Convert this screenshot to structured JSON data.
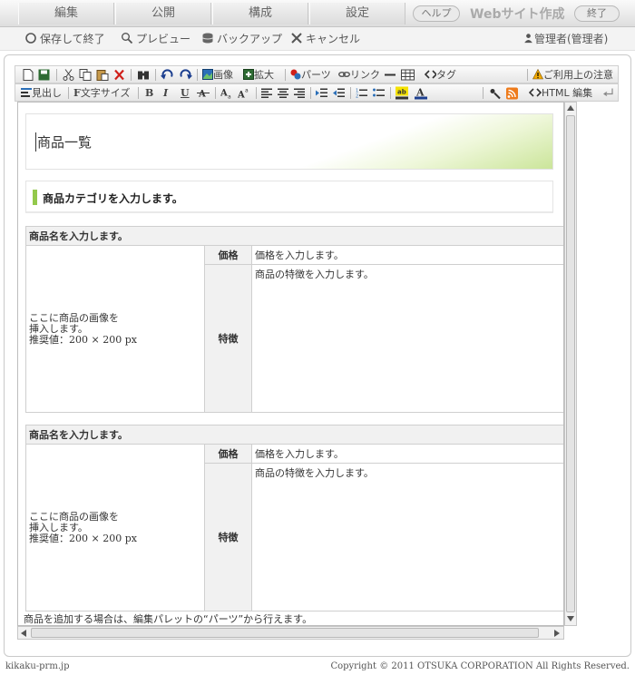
{
  "topmenu": {
    "tabs": [
      "編集",
      "公開",
      "構成",
      "設定"
    ],
    "help": "ヘルプ",
    "app_title": "Webサイト作成",
    "exit": "終了"
  },
  "actions": {
    "save_exit": "保存して終了",
    "preview": "プレビュー",
    "backup": "バックアップ",
    "cancel": "キャンセル",
    "user": "管理者(管理者)"
  },
  "toolbar1": {
    "image": "画像",
    "zoom": "拡大",
    "parts": "パーツ",
    "link": "リンク",
    "tag": "タグ",
    "notice": "ご利用上の注意"
  },
  "toolbar2": {
    "heading": "見出し",
    "font_size": "文字サイズ",
    "bold": "B",
    "italic": "I",
    "underline": "U",
    "html_edit": "HTML 編集"
  },
  "content": {
    "page_title": "商品一覧",
    "category": "商品カテゴリを入力します。",
    "products": [
      {
        "name": "商品名を入力します。",
        "price_label": "価格",
        "price": "価格を入力します。",
        "feature_label": "特徴",
        "feature": "商品の特徴を入力します。",
        "image_line1": "ここに商品の画像を",
        "image_line2": "挿入します。",
        "image_line3": "推奨値：200 × 200 px"
      },
      {
        "name": "商品名を入力します。",
        "price_label": "価格",
        "price": "価格を入力します。",
        "feature_label": "特徴",
        "feature": "商品の特徴を入力します。",
        "image_line1": "ここに商品の画像を",
        "image_line2": "挿入します。",
        "image_line3": "推奨値：200 × 200 px"
      }
    ],
    "footer_note": "商品を追加する場合は、編集パレットの“パーツ”から行えます。"
  },
  "footer": {
    "domain": "kikaku-prm.jp",
    "copyright": "Copyright © 2011 OTSUKA CORPORATION All Rights Reserved."
  },
  "colors": {
    "accent_green": "#93c94c",
    "warning": "#f2a900"
  }
}
